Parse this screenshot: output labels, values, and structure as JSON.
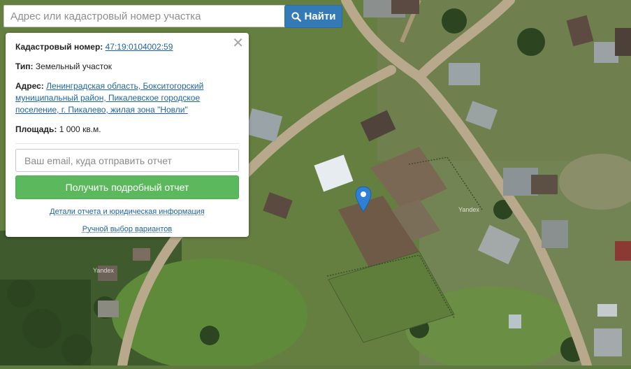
{
  "search": {
    "placeholder": "Адрес или кадастровый номер участка",
    "value": "",
    "button_label": "Найти",
    "button_icon": "search-icon"
  },
  "panel": {
    "cadastral_label": "Кадастровый номер:",
    "cadastral_value": "47:19:0104002:59",
    "type_label": "Тип:",
    "type_value": "Земельный участок",
    "address_label": "Адрес:",
    "address_value": "Ленинградская область, Бокситогорский муниципальный район, Пикалевское городское поселение, г. Пикалево, жилая зона \"Новли\"",
    "area_label": "Площадь:",
    "area_value": "1 000 кв.м.",
    "email_placeholder": "Ваш email, куда отправить отчет",
    "report_button": "Получить подробный отчет",
    "details_link": "Детали отчета и юридическая информация",
    "manual_link": "Ручной выбор вариантов",
    "close_icon": "close-icon"
  },
  "map": {
    "watermarks": [
      "Yandex",
      "Yandex"
    ],
    "marker_icon": "map-pin-icon",
    "marker_color": "#2f7fd6"
  },
  "colors": {
    "search_button": "#337ab7",
    "report_button": "#5cb85c",
    "link": "#1e63a8"
  }
}
